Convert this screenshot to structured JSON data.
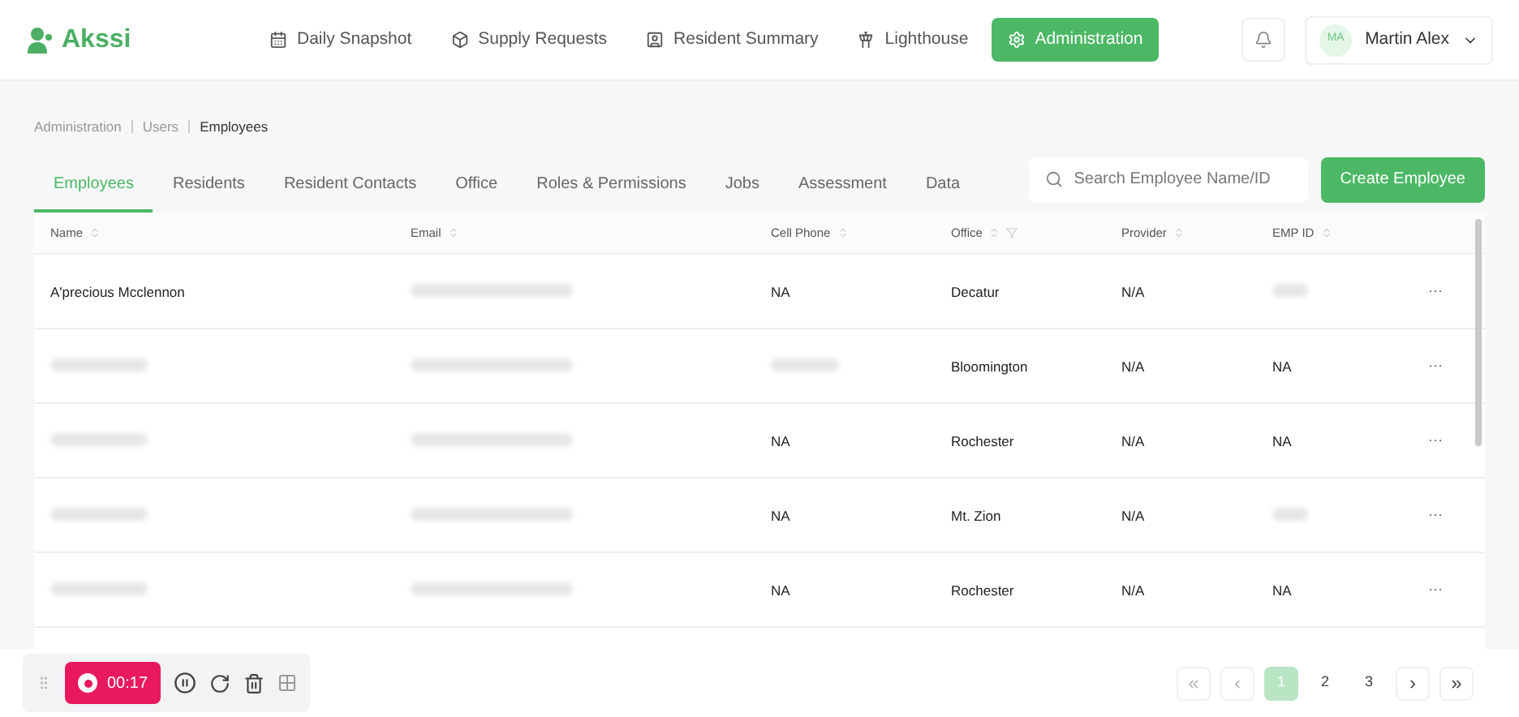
{
  "logo": {
    "name": "Akssi"
  },
  "nav": [
    {
      "label": "Daily Snapshot",
      "selected": false
    },
    {
      "label": "Supply Requests",
      "selected": false
    },
    {
      "label": "Resident Summary",
      "selected": false
    },
    {
      "label": "Lighthouse",
      "selected": false
    },
    {
      "label": "Administration",
      "selected": true
    }
  ],
  "user": {
    "initials": "MA",
    "name": "Martin Alex"
  },
  "breadcrumb": [
    {
      "label": "Administration",
      "current": false
    },
    {
      "label": "Users",
      "current": false
    },
    {
      "label": "Employees",
      "current": true
    }
  ],
  "tabs": [
    {
      "label": "Employees",
      "selected": true
    },
    {
      "label": "Residents",
      "selected": false
    },
    {
      "label": "Resident Contacts",
      "selected": false
    },
    {
      "label": "Office",
      "selected": false
    },
    {
      "label": "Roles & Permissions",
      "selected": false
    },
    {
      "label": "Jobs",
      "selected": false
    },
    {
      "label": "Assessment",
      "selected": false
    },
    {
      "label": "Data",
      "selected": false
    }
  ],
  "search": {
    "placeholder": "Search Employee Name/ID"
  },
  "create_button": "Create Employee",
  "table": {
    "columns": [
      {
        "label": "Name",
        "filter": false
      },
      {
        "label": "Email",
        "filter": false
      },
      {
        "label": "Cell Phone",
        "filter": false
      },
      {
        "label": "Office",
        "filter": true
      },
      {
        "label": "Provider",
        "filter": false
      },
      {
        "label": "EMP ID",
        "filter": false
      }
    ],
    "rows": [
      {
        "cells": [
          {
            "kind": "text",
            "text": "A'precious Mcclennon"
          },
          {
            "kind": "blurred"
          },
          {
            "kind": "text",
            "text": "NA"
          },
          {
            "kind": "text",
            "text": "Decatur"
          },
          {
            "kind": "text",
            "text": "N/A"
          },
          {
            "kind": "blurred"
          }
        ],
        "menu": "···"
      },
      {
        "cells": [
          {
            "kind": "blurred"
          },
          {
            "kind": "blurred"
          },
          {
            "kind": "blurred"
          },
          {
            "kind": "text",
            "text": "Bloomington"
          },
          {
            "kind": "text",
            "text": "N/A"
          },
          {
            "kind": "text",
            "text": "NA"
          }
        ],
        "menu": "···"
      },
      {
        "cells": [
          {
            "kind": "blurred"
          },
          {
            "kind": "blurred"
          },
          {
            "kind": "text",
            "text": "NA"
          },
          {
            "kind": "text",
            "text": "Rochester"
          },
          {
            "kind": "text",
            "text": "N/A"
          },
          {
            "kind": "text",
            "text": "NA"
          }
        ],
        "menu": "···"
      },
      {
        "cells": [
          {
            "kind": "blurred"
          },
          {
            "kind": "blurred"
          },
          {
            "kind": "text",
            "text": "NA"
          },
          {
            "kind": "text",
            "text": "Mt. Zion"
          },
          {
            "kind": "text",
            "text": "N/A"
          },
          {
            "kind": "blurred"
          }
        ],
        "menu": "···"
      },
      {
        "cells": [
          {
            "kind": "blurred"
          },
          {
            "kind": "blurred"
          },
          {
            "kind": "text",
            "text": "NA"
          },
          {
            "kind": "text",
            "text": "Rochester"
          },
          {
            "kind": "text",
            "text": "N/A"
          },
          {
            "kind": "text",
            "text": "NA"
          }
        ],
        "menu": "···"
      }
    ]
  },
  "recorder": {
    "time": "00:17"
  },
  "pagination": [
    {
      "label": "«",
      "kind": "nav",
      "selected": false,
      "disabled": true
    },
    {
      "label": "‹",
      "kind": "nav",
      "selected": false,
      "disabled": true
    },
    {
      "label": "1",
      "kind": "page",
      "selected": true,
      "disabled": false
    },
    {
      "label": "2",
      "kind": "page",
      "selected": false,
      "disabled": false
    },
    {
      "label": "3",
      "kind": "page",
      "selected": false,
      "disabled": false
    },
    {
      "label": "›",
      "kind": "nav",
      "selected": false,
      "disabled": false
    },
    {
      "label": "»",
      "kind": "nav",
      "selected": false,
      "disabled": false
    }
  ]
}
